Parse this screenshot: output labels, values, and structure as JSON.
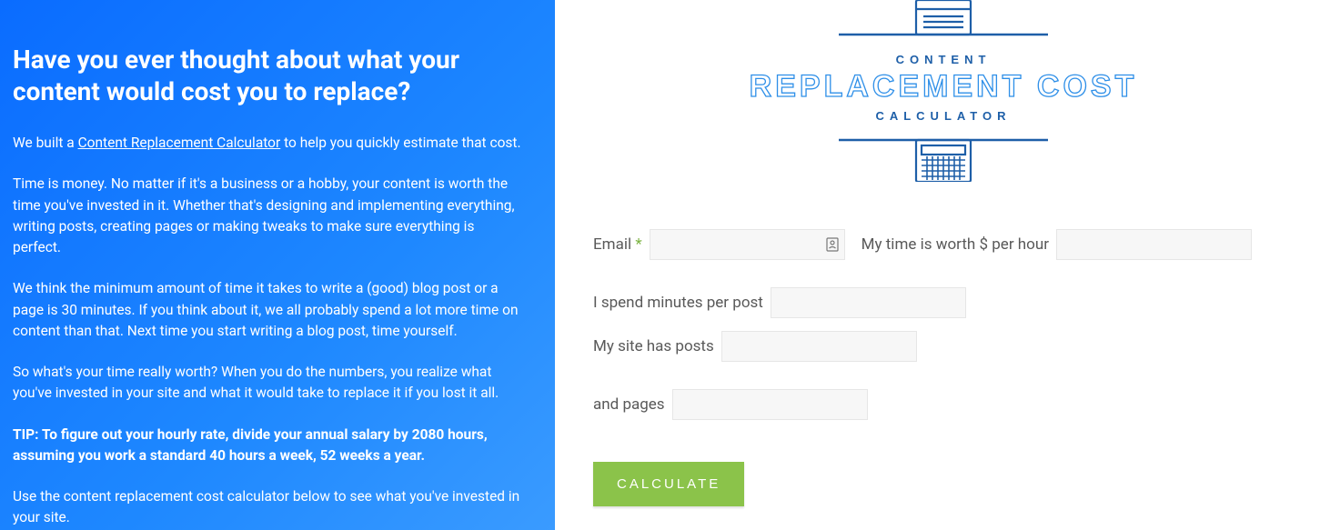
{
  "left": {
    "heading": "Have you ever thought about what your content would cost you to replace?",
    "p1_pre": "We built a ",
    "p1_link": "Content Replacement Calculator",
    "p1_post": " to help you quickly estimate that cost.",
    "p2": "Time is money. No matter if it's a business or a hobby, your content is worth the time you've invested in it. Whether that's designing and implementing everything, writing posts, creating pages or making tweaks to make sure everything is perfect.",
    "p3": "We think the minimum amount of time it takes to write a (good) blog post or a page is 30 minutes. If you think about it, we all probably spend a lot more time on content than that. Next time you start writing a blog post, time yourself.",
    "p4": "So what's your time really worth? When you do the numbers, you realize what you've invested in your site and what it would take to replace it if you lost it all.",
    "tip": "TIP: To figure out your hourly rate, divide your annual salary by 2080 hours, assuming you work a standard 40 hours a week, 52 weeks a year.",
    "p5": "Use the content replacement cost calculator below to see what you've invested in your site."
  },
  "logo": {
    "line1": "CONTENT",
    "line2": "REPLACEMENT COST",
    "line3": "CALCULATOR"
  },
  "form": {
    "email_label": "Email",
    "required": "*",
    "time_label": "My time is worth $ per hour",
    "minutes_label": "I spend minutes per post",
    "posts_label": "My site has posts",
    "pages_label": "and pages",
    "button": "CALCULATE"
  }
}
